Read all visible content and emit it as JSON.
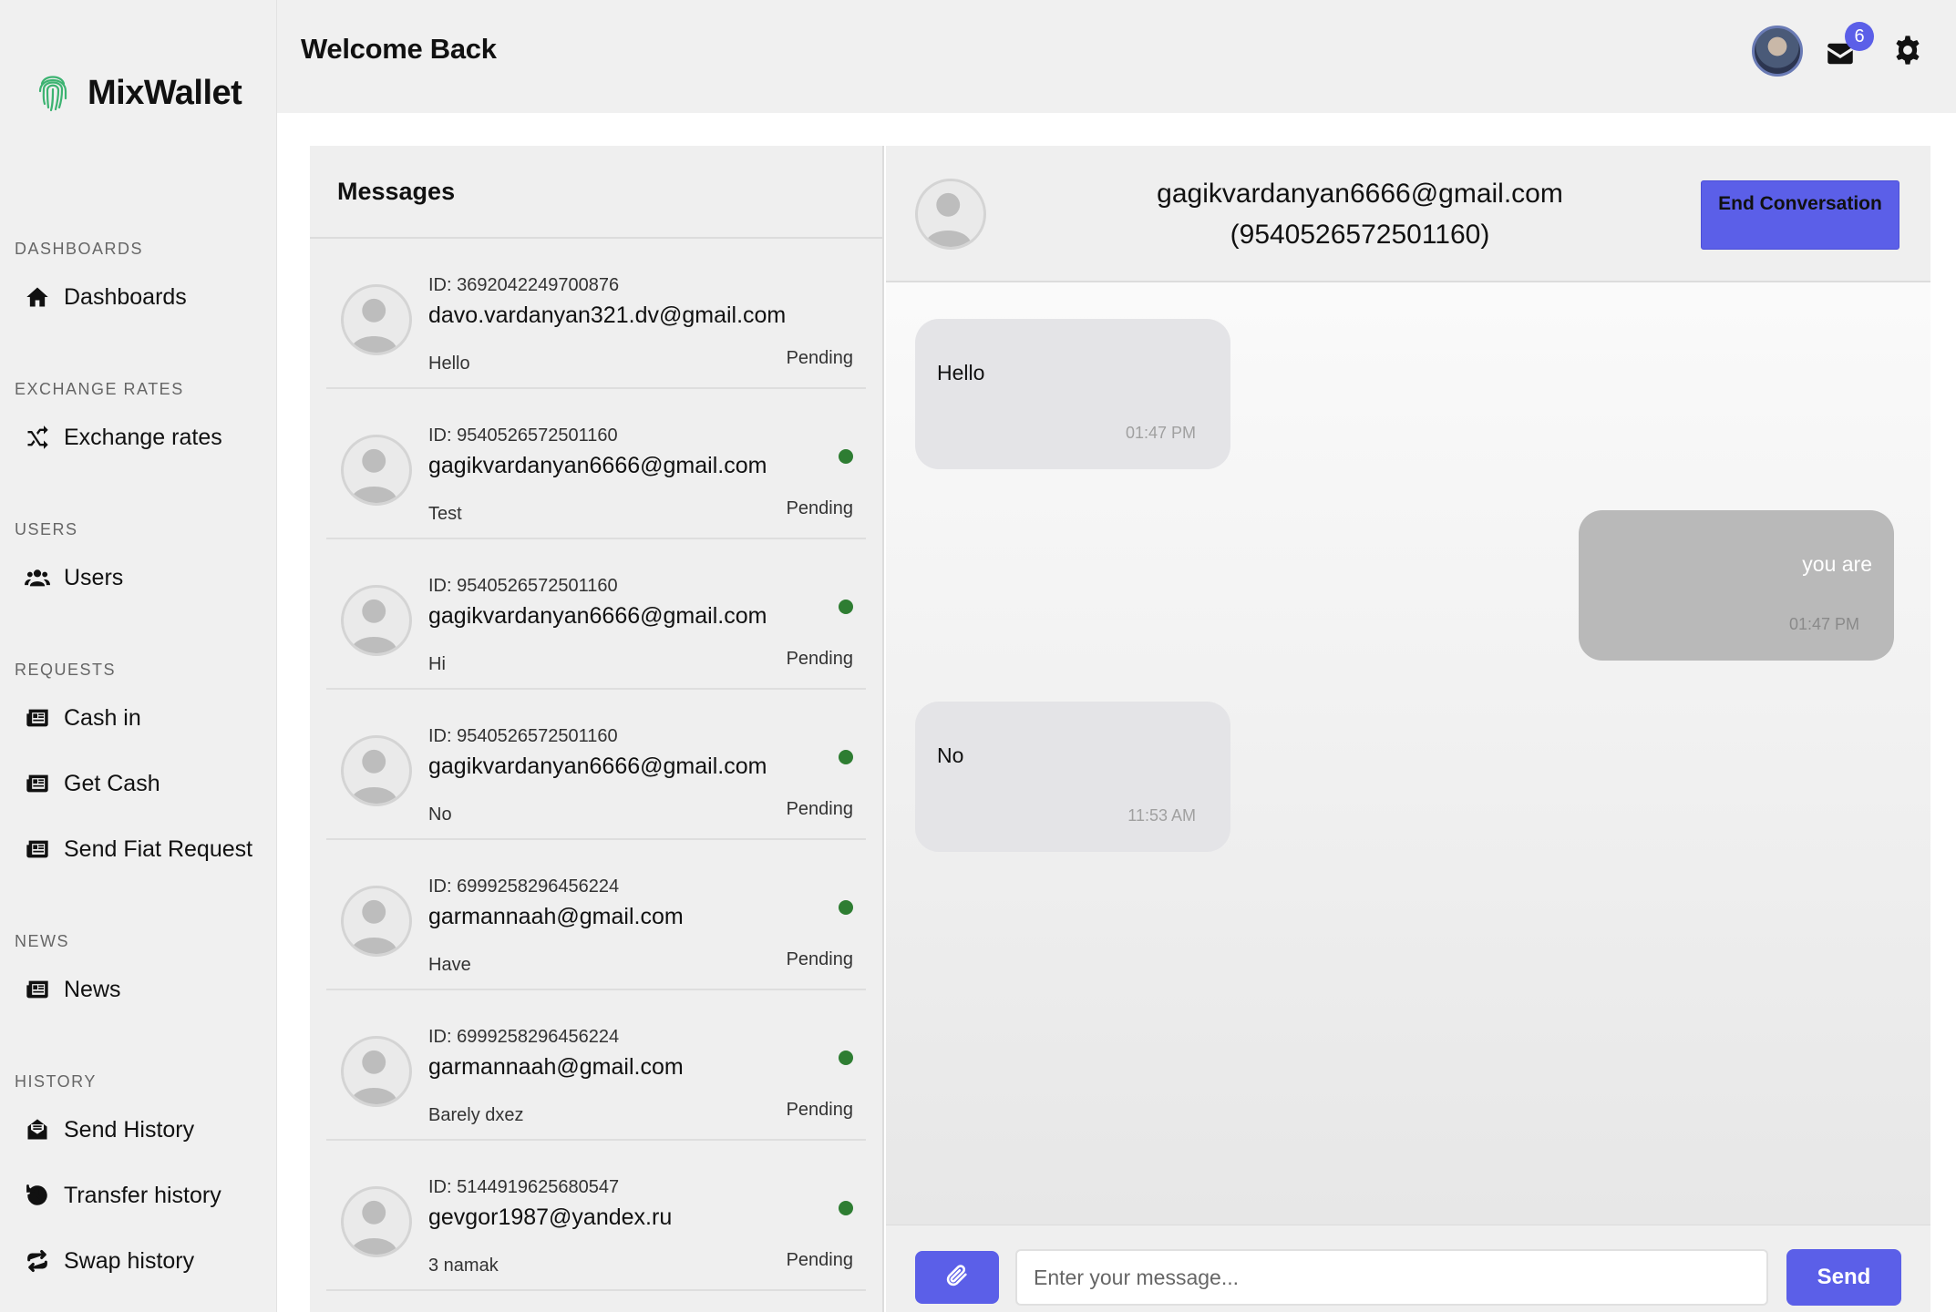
{
  "brand": {
    "name": "MixWallet",
    "logo_icon": "fingerprint-icon",
    "logo_color": "#3cb371"
  },
  "header": {
    "title": "Welcome Back",
    "mail_count": "6"
  },
  "sidebar": {
    "sections": [
      {
        "title": "DASHBOARDS",
        "items": [
          {
            "label": "Dashboards",
            "icon": "home-icon"
          }
        ]
      },
      {
        "title": "EXCHANGE RATES",
        "items": [
          {
            "label": "Exchange rates",
            "icon": "shuffle-icon"
          }
        ]
      },
      {
        "title": "USERS",
        "items": [
          {
            "label": "Users",
            "icon": "users-icon"
          }
        ]
      },
      {
        "title": "REQUESTS",
        "items": [
          {
            "label": "Cash in",
            "icon": "newspaper-icon"
          },
          {
            "label": "Get Cash",
            "icon": "newspaper-icon"
          },
          {
            "label": "Send Fiat Request",
            "icon": "newspaper-icon"
          }
        ]
      },
      {
        "title": "NEWS",
        "items": [
          {
            "label": "News",
            "icon": "newspaper-icon"
          }
        ]
      },
      {
        "title": "HISTORY",
        "items": [
          {
            "label": "Send History",
            "icon": "envelope-open-icon"
          },
          {
            "label": "Transfer history",
            "icon": "history-icon"
          },
          {
            "label": "Swap history",
            "icon": "repeat-icon"
          }
        ]
      }
    ]
  },
  "messages": {
    "title": "Messages",
    "conversations": [
      {
        "id": "ID: 3692042249700876",
        "email": "davo.vardanyan321.dv@gmail.com",
        "last": "Hello",
        "status": "Pending",
        "online": false
      },
      {
        "id": "ID: 9540526572501160",
        "email": "gagikvardanyan6666@gmail.com",
        "last": "Test",
        "status": "Pending",
        "online": true
      },
      {
        "id": "ID: 9540526572501160",
        "email": "gagikvardanyan6666@gmail.com",
        "last": "Hi",
        "status": "Pending",
        "online": true
      },
      {
        "id": "ID: 9540526572501160",
        "email": "gagikvardanyan6666@gmail.com",
        "last": "No",
        "status": "Pending",
        "online": true
      },
      {
        "id": "ID: 6999258296456224",
        "email": "garmannaah@gmail.com",
        "last": "Have",
        "status": "Pending",
        "online": true
      },
      {
        "id": "ID: 6999258296456224",
        "email": "garmannaah@gmail.com",
        "last": "Barely dxez",
        "status": "Pending",
        "online": true
      },
      {
        "id": "ID: 5144919625680547",
        "email": "gevgor1987@yandex.ru",
        "last": "3 namak",
        "status": "Pending",
        "online": true
      }
    ]
  },
  "chat": {
    "email": "gagikvardanyan6666@gmail.com",
    "user_id": "(9540526572501160)",
    "end_button": "End Conversation",
    "messages": [
      {
        "text": "Hello",
        "time": "01:47 PM",
        "direction": "incoming"
      },
      {
        "text": "you are",
        "time": "01:47 PM",
        "direction": "outgoing"
      },
      {
        "text": "No",
        "time": "11:53 AM",
        "direction": "incoming"
      }
    ],
    "input_placeholder": "Enter your message...",
    "send_label": "Send",
    "attach_icon": "paperclip-icon"
  },
  "colors": {
    "accent": "#5b5fe8",
    "online": "#2e7d32"
  }
}
